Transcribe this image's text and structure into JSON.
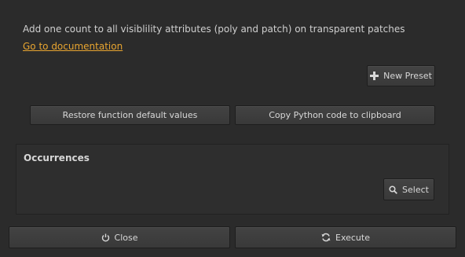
{
  "description": "Add one count to all visiblility attributes (poly and patch) on transparent patches",
  "documentation_link": "Go to documentation",
  "buttons": {
    "new_preset": "New Preset",
    "restore_defaults": "Restore function default values",
    "copy_python": "Copy Python code to clipboard",
    "close": "Close",
    "execute": "Execute"
  },
  "occurrences": {
    "title": "Occurrences",
    "select_label": "Select"
  },
  "icons": {
    "new_preset": "plus-icon",
    "select": "search-icon",
    "close": "power-icon",
    "execute": "refresh-icon"
  },
  "colors": {
    "background": "#2b2b2b",
    "link": "#e8a530",
    "text": "#cfcfcf"
  }
}
